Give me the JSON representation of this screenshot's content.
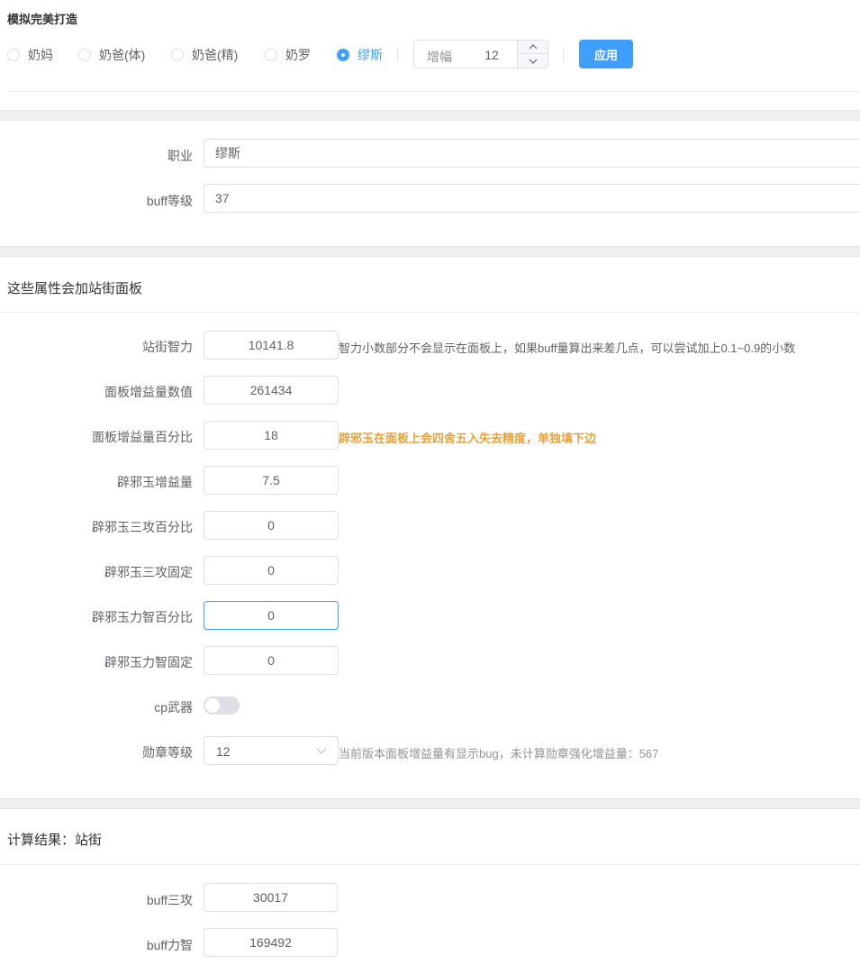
{
  "header": {
    "title": "模拟完美打造"
  },
  "classes": {
    "options": [
      "奶妈",
      "奶爸(体)",
      "奶爸(精)",
      "奶罗",
      "缪斯"
    ],
    "selected": "缪斯"
  },
  "amplify": {
    "prefix": "增幅",
    "value": "12"
  },
  "apply_label": "应用",
  "basic": {
    "job_label": "职业",
    "job_value": "缪斯",
    "buff_level_label": "buff等级",
    "buff_level_value": "37"
  },
  "panel": {
    "section_title": "这些属性会加站街面板",
    "fields": [
      {
        "label": "站街智力",
        "value": "10141.8"
      },
      {
        "label": "面板增益量数值",
        "value": "261434"
      },
      {
        "label": "面板增益量百分比",
        "value": "18"
      },
      {
        "label": "辟邪玉增益量",
        "value": "7.5"
      },
      {
        "label": "辟邪玉三攻百分比",
        "value": "0"
      },
      {
        "label": "辟邪玉三攻固定",
        "value": "0"
      },
      {
        "label": "辟邪玉力智百分比",
        "value": "0"
      },
      {
        "label": "辟邪玉力智固定",
        "value": "0"
      }
    ],
    "hint_int": "智力小数部分不会显示在面板上，如果buff量算出来差几点，可以尝试加上0.1~0.9的小数",
    "hint_percent": "辟邪玉在面板上会四舍五入失去精度，单独填下边",
    "cp_label": "cp武器",
    "cp_enabled": false,
    "medal_label": "勋章等级",
    "medal_value": "12",
    "medal_hint": "当前版本面板增益量有显示bug，未计算勋章强化增益量：567"
  },
  "result": {
    "section_title": "计算结果：站街",
    "atk_label": "buff三攻",
    "atk_value": "30017",
    "int_label": "buff力智",
    "int_value": "169492"
  },
  "colors": {
    "accent": "#409eff",
    "warning": "#e6a23c"
  }
}
